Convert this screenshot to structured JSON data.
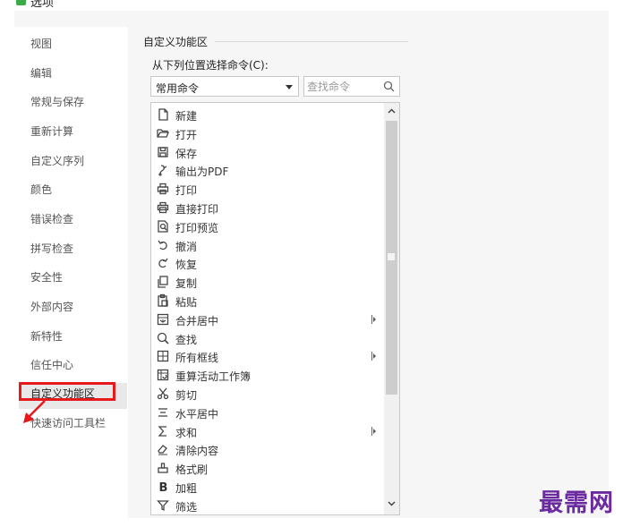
{
  "window": {
    "title": "选项"
  },
  "sidebar": {
    "items": [
      {
        "label": "视图"
      },
      {
        "label": "编辑"
      },
      {
        "label": "常规与保存"
      },
      {
        "label": "重新计算"
      },
      {
        "label": "自定义序列"
      },
      {
        "label": "颜色"
      },
      {
        "label": "错误检查"
      },
      {
        "label": "拼写检查"
      },
      {
        "label": "安全性"
      },
      {
        "label": "外部内容"
      },
      {
        "label": "新特性"
      },
      {
        "label": "信任中心"
      },
      {
        "label": "自定义功能区",
        "selected": true
      },
      {
        "label": "快速访问工具栏"
      }
    ]
  },
  "main": {
    "section_title": "自定义功能区",
    "from_label": "从下列位置选择命令(C):",
    "dropdown_value": "常用命令",
    "search_placeholder": "查找命令",
    "commands": [
      {
        "label": "新建",
        "icon": "new-document-icon"
      },
      {
        "label": "打开",
        "icon": "folder-open-icon"
      },
      {
        "label": "保存",
        "icon": "save-icon"
      },
      {
        "label": "输出为PDF",
        "icon": "pdf-export-icon"
      },
      {
        "label": "打印",
        "icon": "printer-icon"
      },
      {
        "label": "直接打印",
        "icon": "direct-print-icon"
      },
      {
        "label": "打印预览",
        "icon": "print-preview-icon"
      },
      {
        "label": "撤消",
        "icon": "undo-icon"
      },
      {
        "label": "恢复",
        "icon": "redo-icon"
      },
      {
        "label": "复制",
        "icon": "copy-icon"
      },
      {
        "label": "粘贴",
        "icon": "paste-icon"
      },
      {
        "label": "合并居中",
        "icon": "merge-center-icon",
        "submenu": true
      },
      {
        "label": "查找",
        "icon": "magnifier-icon"
      },
      {
        "label": "所有框线",
        "icon": "all-borders-icon",
        "submenu": true
      },
      {
        "label": "重算活动工作簿",
        "icon": "recalculate-icon"
      },
      {
        "label": "剪切",
        "icon": "scissors-icon"
      },
      {
        "label": "水平居中",
        "icon": "align-center-icon"
      },
      {
        "label": "求和",
        "icon": "sigma-icon",
        "submenu": true
      },
      {
        "label": "清除内容",
        "icon": "eraser-icon"
      },
      {
        "label": "格式刷",
        "icon": "format-painter-icon"
      },
      {
        "label": "加粗",
        "icon": "bold-icon"
      },
      {
        "label": "筛选",
        "icon": "filter-icon"
      }
    ]
  },
  "watermark": "最需网",
  "colors": {
    "highlight": "#e8191c",
    "watermark": "#6a2aa0",
    "app_logo": "#3bab47"
  }
}
